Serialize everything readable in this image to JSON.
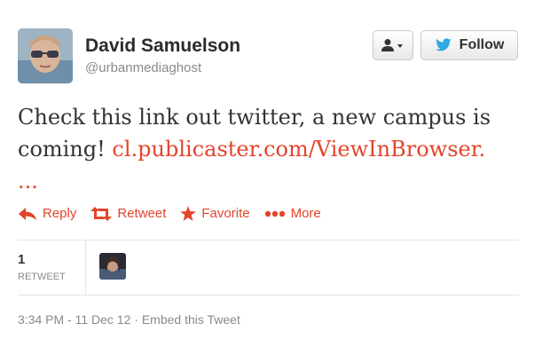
{
  "author": {
    "name": "David Samuelson",
    "handle": "@urbanmediaghost"
  },
  "header_buttons": {
    "user_menu_icon": "user-dropdown-icon",
    "follow_label": "Follow",
    "follow_icon": "twitter-bird-icon"
  },
  "tweet": {
    "text": "Check this link out twitter, a new campus is coming! ",
    "link": "cl.publicaster.com/ViewInBrowser.",
    "link_cont": "..."
  },
  "actions": {
    "reply": "Reply",
    "retweet": "Retweet",
    "favorite": "Favorite",
    "more": "More"
  },
  "stats": {
    "retweet_count": "1",
    "retweet_label": "RETWEET"
  },
  "meta": {
    "time": "3:34 PM - 11 Dec 12",
    "separator": " · ",
    "embed": "Embed this Tweet"
  },
  "colors": {
    "link": "#e4442a",
    "follow_bird": "#2fa9e0"
  }
}
